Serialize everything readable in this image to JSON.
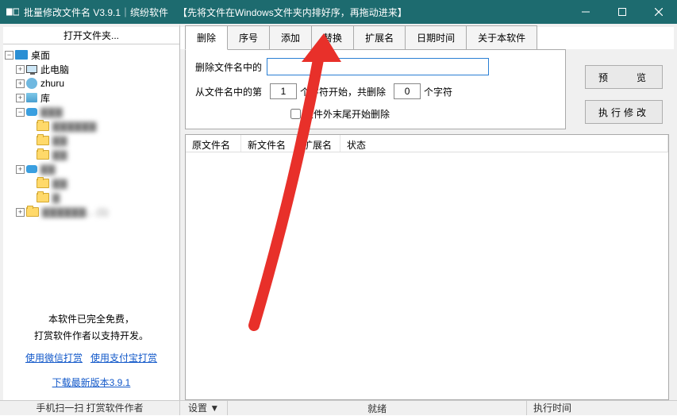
{
  "titlebar": {
    "title": "批量修改文件名  V3.9.1｜缤纷软件",
    "hint": "【先将文件在Windows文件夹内排好序，再拖动进来】"
  },
  "leftPanel": {
    "header": "打开文件夹...",
    "tree": {
      "root": "桌面",
      "items": [
        "此电脑",
        "zhuru",
        "库",
        "▇▇▇",
        "▇▇▇▇▇▇",
        "▇▇",
        "▇▇",
        "▇▇",
        "▇▇",
        "▇",
        "▇▇▇▇▇▇... (1)"
      ]
    },
    "promo": {
      "line1": "本软件已完全免费，",
      "line2": "打赏软件作者以支持开发。",
      "link1": "使用微信打赏",
      "link2": "使用支付宝打赏",
      "link3": "下载最新版本3.9.1"
    },
    "footer": "手机扫一扫 打赏软件作者"
  },
  "tabs": [
    "删除",
    "序号",
    "添加",
    "替换",
    "扩展名",
    "日期时间",
    "关于本软件"
  ],
  "activeTab": 0,
  "deleteTab": {
    "label1": "删除文件名中的",
    "input1": "",
    "label2a": "从文件名中的第",
    "spin1": "1",
    "label2b": "个字符开始，共删除",
    "spin2": "0",
    "label2c": "个字符",
    "check1": "文件外末尾开始删除"
  },
  "actions": {
    "preview": "预　　览",
    "execute": "执行修改"
  },
  "grid": {
    "cols": [
      "原文件名",
      "新文件名",
      "扩展名",
      "状态"
    ]
  },
  "statusbar": {
    "settings": "设置 ▼",
    "ready": "就绪",
    "time": "执行时间"
  }
}
